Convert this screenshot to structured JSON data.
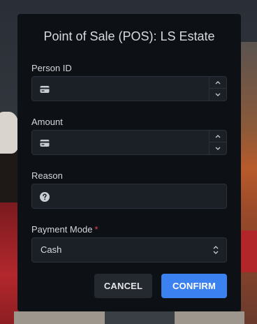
{
  "dialog": {
    "title": "Point of Sale (POS): LS Estate"
  },
  "fields": {
    "person_id": {
      "label": "Person ID",
      "value": "",
      "icon": "id-card-icon"
    },
    "amount": {
      "label": "Amount",
      "value": "",
      "icon": "id-card-icon"
    },
    "reason": {
      "label": "Reason",
      "value": "",
      "icon": "question-circle-icon"
    },
    "payment_mode": {
      "label": "Payment Mode",
      "required_marker": "*",
      "selected": "Cash"
    }
  },
  "buttons": {
    "cancel": "CANCEL",
    "confirm": "CONFIRM"
  },
  "colors": {
    "dialog_bg": "#0d1116",
    "field_bg": "#1b1f26",
    "accent": "#3b82f0",
    "required": "#e0434e"
  }
}
